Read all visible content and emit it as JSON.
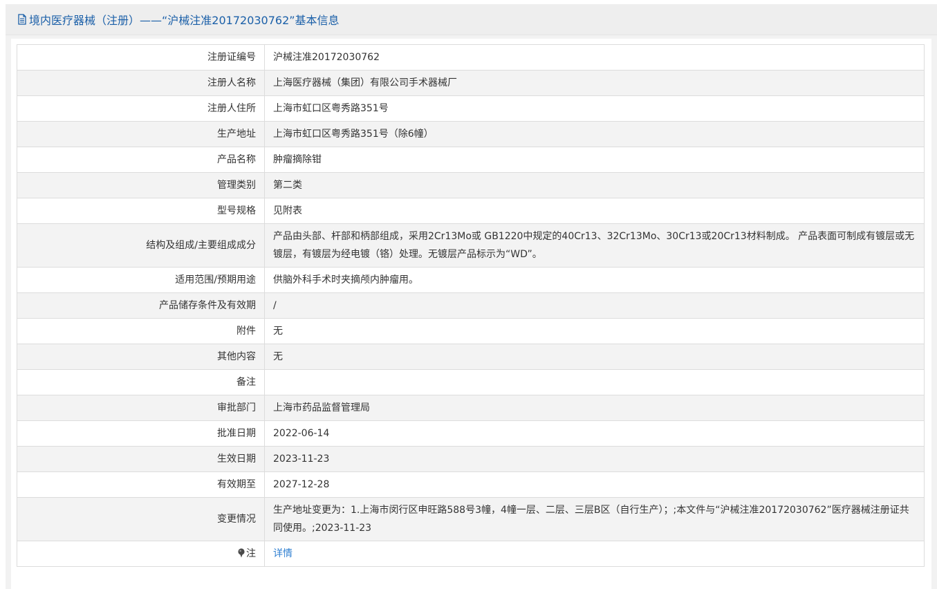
{
  "header": {
    "title": "境内医疗器械（注册）——“沪械注准20172030762”基本信息",
    "icon": "document-icon",
    "color": "#1a5fa8"
  },
  "rows": [
    {
      "label": "注册证编号",
      "value": "沪械注准20172030762"
    },
    {
      "label": "注册人名称",
      "value": "上海医疗器械（集团）有限公司手术器械厂"
    },
    {
      "label": "注册人住所",
      "value": "上海市虹口区粤秀路351号"
    },
    {
      "label": "生产地址",
      "value": "上海市虹口区粤秀路351号（除6幢）"
    },
    {
      "label": "产品名称",
      "value": "肿瘤摘除钳"
    },
    {
      "label": "管理类别",
      "value": "第二类"
    },
    {
      "label": "型号规格",
      "value": "见附表"
    },
    {
      "label": "结构及组成/主要组成成分",
      "value": "产品由头部、杆部和柄部组成，采用2Cr13Mo或 GB1220中规定的40Cr13、32Cr13Mo、30Cr13或20Cr13材料制成。 产品表面可制成有镀层或无镀层，有镀层为经电镀（铬）处理。无镀层产品标示为“WD”。"
    },
    {
      "label": "适用范围/预期用途",
      "value": "供脑外科手术时夹摘颅内肿瘤用。"
    },
    {
      "label": "产品储存条件及有效期",
      "value": "/"
    },
    {
      "label": "附件",
      "value": "无"
    },
    {
      "label": "其他内容",
      "value": "无"
    },
    {
      "label": "备注",
      "value": ""
    },
    {
      "label": "审批部门",
      "value": "上海市药品监督管理局"
    },
    {
      "label": "批准日期",
      "value": "2022-06-14"
    },
    {
      "label": "生效日期",
      "value": "2023-11-23"
    },
    {
      "label": "有效期至",
      "value": "2027-12-28"
    },
    {
      "label": "变更情况",
      "value": "生产地址变更为：1.上海市闵行区申旺路588号3幢，4幢一层、二层、三层B区（自行生产）；;本文件与“沪械注准20172030762”医疗器械注册证共同使用。;2023-11-23"
    }
  ],
  "note": {
    "label": "注",
    "icon": "pin-icon",
    "link_text": "详情",
    "link_color": "#2f7fd1"
  }
}
